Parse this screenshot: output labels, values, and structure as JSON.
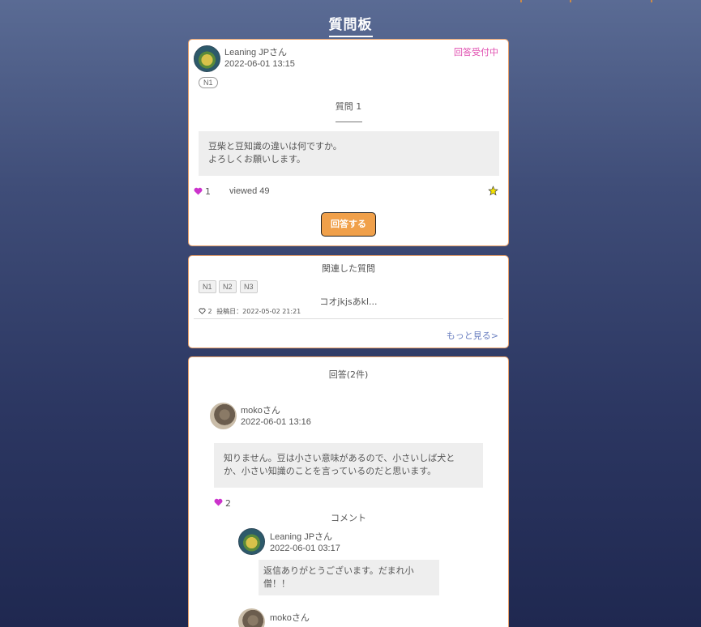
{
  "header": {
    "title": "質問板"
  },
  "question": {
    "author": "Leaning JPさん",
    "date": "2022-06-01 13:15",
    "status": "回答受付中",
    "tag": "N1",
    "title": "質問 1",
    "body_line1": "豆柴と豆知識の違いは何ですか。",
    "body_line2": "よろしくお願いします。",
    "likes": "1",
    "views": "viewed 49",
    "answer_button": "回答する"
  },
  "related": {
    "heading": "関連した質問",
    "tags": [
      "N1",
      "N2",
      "N3"
    ],
    "item_title": "コオjkjsあkl...",
    "item_likes": "2",
    "item_date": "投稿日：2022-05-02 21:21",
    "more": "もっと見る>"
  },
  "answers": {
    "heading": "回答(2件)",
    "first": {
      "author": "mokoさん",
      "date": "2022-06-01 13:16",
      "body_line1": "知りません。豆は小さい意味があるので、小さいしば犬と",
      "body_line2": "か、小さい知識のことを言っているのだと思います。",
      "likes": "2"
    },
    "comment_heading": "コメント",
    "comments": [
      {
        "author": "Leaning JPさん",
        "date": "2022-06-01 03:17",
        "body_line1": "返信ありがとうございます。だまれ小",
        "body_line2": "僧！！"
      },
      {
        "author": "mokoさん"
      }
    ]
  },
  "colors": {
    "accent": "#f0a04a",
    "status": "#e04fb0",
    "heart": "#cc33cc",
    "link": "#6a7fc0"
  }
}
